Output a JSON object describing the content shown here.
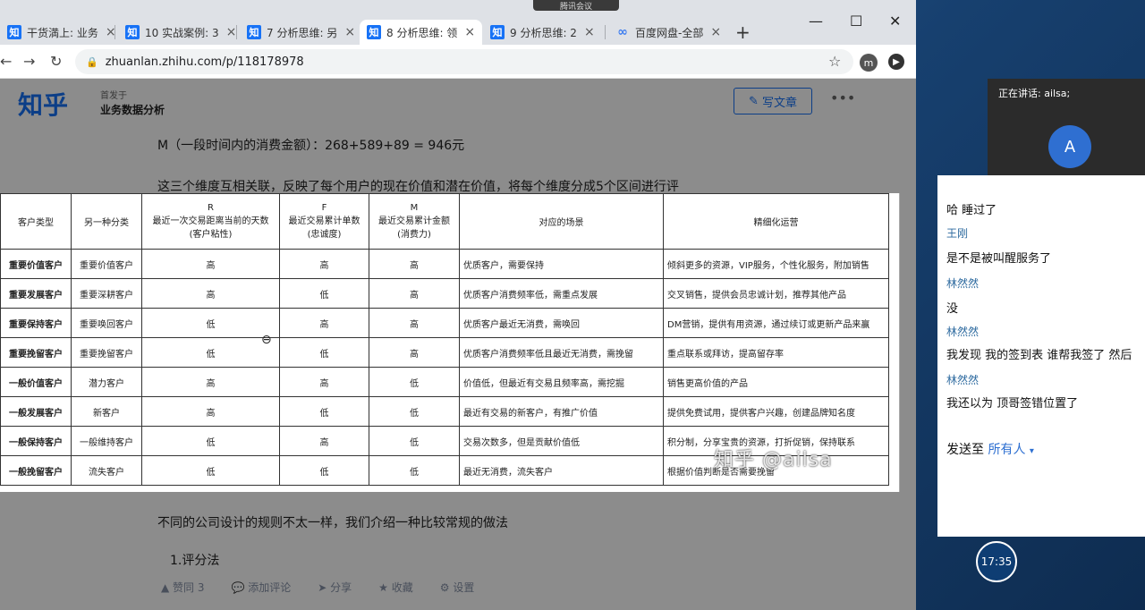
{
  "browser": {
    "tabs": [
      {
        "title": "干货満上: 业务",
        "icon": "知"
      },
      {
        "title": "10 实战案例: 3",
        "icon": "知"
      },
      {
        "title": "7 分析思维: 另",
        "icon": "知"
      },
      {
        "title": "8 分析思维: 领",
        "icon": "知"
      },
      {
        "title": "9 分析思维: 2",
        "icon": "知"
      },
      {
        "title": "百度网盘-全部",
        "icon": "∞"
      }
    ],
    "url": "zhuanlan.zhihu.com/p/118178978",
    "profile_initial": "m"
  },
  "page": {
    "logo": "知乎",
    "author": "首发于",
    "column_title": "业务数据分析",
    "write_button": "写文章",
    "line_m": "M（一段时间内的消费金额）：268+589+89 = 946元",
    "line_intro": "这三个维度互相关联，反映了每个用户的现在价值和潜在价值，将每个维度分成5个区间进行评",
    "line_bottom": "不同的公司设计的规则不太一样，我们介绍一种比较常规的做法",
    "line_next": "1.评分法",
    "actions": {
      "like": "赞同 3",
      "comment": "添加评论",
      "share": "分享",
      "fav": "收藏",
      "settings": "设置"
    }
  },
  "table": {
    "headers": [
      "客户类型",
      "另一种分类",
      "R\n最近一次交易距离当前的天数\n(客户粘性)",
      "F\n最近交易累计单数\n(忠诚度)",
      "M\n最近交易累计金额\n(消费力)",
      "对应的场景",
      "精细化运营"
    ],
    "rows": [
      [
        "重要价值客户",
        "重要价值客户",
        "高",
        "高",
        "高",
        "优质客户，需要保持",
        "倾斜更多的资源，VIP服务，个性化服务，附加销售"
      ],
      [
        "重要发展客户",
        "重要深耕客户",
        "高",
        "低",
        "高",
        "优质客户消费频率低，需重点发展",
        "交叉销售，提供会员忠诚计划，推荐其他产品"
      ],
      [
        "重要保持客户",
        "重要唤回客户",
        "低",
        "高",
        "高",
        "优质客户最近无消费，需唤回",
        "DM营销，提供有用资源，通过续订或更新产品来赢"
      ],
      [
        "重要挽留客户",
        "重要挽留客户",
        "低",
        "低",
        "高",
        "优质客户消费频率低且最近无消费，需挽留",
        "重点联系或拜访，提高留存率"
      ],
      [
        "一般价值客户",
        "潜力客户",
        "高",
        "高",
        "低",
        "价值低，但最近有交易且频率高，需挖掘",
        "销售更高价值的产品"
      ],
      [
        "一般发展客户",
        "新客户",
        "高",
        "低",
        "低",
        "最近有交易的新客户，有推广价值",
        "提供免费试用，提供客户兴趣，创建品牌知名度"
      ],
      [
        "一般保持客户",
        "一般维持客户",
        "低",
        "高",
        "低",
        "交易次数多，但是贡献价值低",
        "积分制，分享宝贵的资源，打折促销，保持联系"
      ],
      [
        "一般挽留客户",
        "流失客户",
        "低",
        "低",
        "低",
        "最近无消费，流失客户",
        "根据价值判断是否需要挽留"
      ]
    ]
  },
  "watermark": "知乎 @ailsa",
  "meeting": {
    "top_label": "腾讯会议",
    "speaking_label": "正在讲话: ailsa;",
    "speaker_initial": "A",
    "speaker_name": "ailsa",
    "chat": [
      {
        "type": "msg",
        "text": "哈  睡过了"
      },
      {
        "type": "name",
        "text": "王刚"
      },
      {
        "type": "msg",
        "text": "是不是被叫醒服务了"
      },
      {
        "type": "name",
        "text": "林然然"
      },
      {
        "type": "msg",
        "text": "没"
      },
      {
        "type": "name",
        "text": "林然然"
      },
      {
        "type": "msg",
        "text": "我发现 我的签到表 谁帮我签了  然后"
      },
      {
        "type": "name",
        "text": "林然然"
      },
      {
        "type": "msg",
        "text": "我还以为 顶哥签错位置了"
      }
    ],
    "send_to_label": "发送至",
    "send_to_target": "所有人",
    "clock": "17:35"
  }
}
